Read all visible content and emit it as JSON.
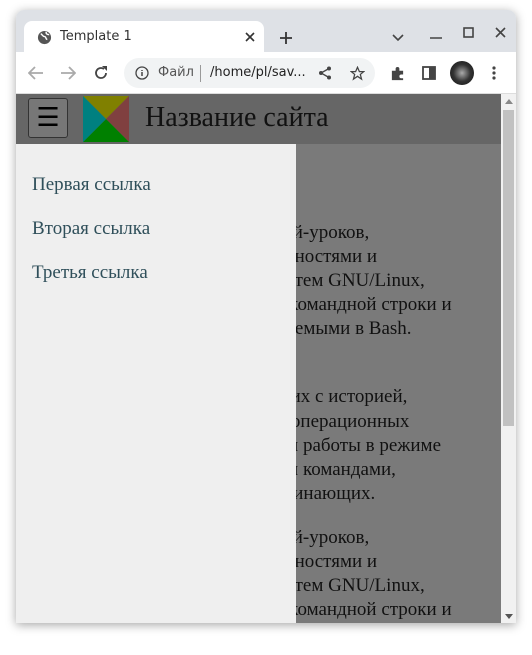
{
  "browser": {
    "tab_title": "Template 1",
    "url_scheme_label": "Файл",
    "url": "/home/pl/sav...",
    "icons": [
      "globe-icon",
      "close-icon",
      "plus-icon",
      "chevron-down-icon",
      "minimize-icon",
      "maximize-icon",
      "window-close-icon",
      "back-icon",
      "forward-icon",
      "reload-icon",
      "info-icon",
      "share-icon",
      "star-icon",
      "extensions-icon",
      "side-panel-icon",
      "avatar",
      "more-icon"
    ]
  },
  "site": {
    "menu_button": "☰",
    "title": "Название сайта",
    "logo_colors": {
      "top": "#808000",
      "right": "#804040",
      "bottom": "#008000",
      "left": "#008080"
    }
  },
  "sidebar": {
    "links": [
      {
        "label": "Первая ссылка"
      },
      {
        "label": "Вторая ссылка"
      },
      {
        "label": "Третья ссылка"
      }
    ]
  },
  "content": {
    "visible_lines": [
      "тей-уроков,",
      "енностями и",
      "истем GNU/Linux,",
      "е командной строки и",
      "няемыми в Bash.",
      "щих с историей,",
      "й операционных",
      "ми работы в режиме",
      "ми командами,",
      "ачинающих.",
      "тей-уроков,",
      "енностями и",
      "истем GNU/Linux,",
      "е командной строки и"
    ]
  }
}
